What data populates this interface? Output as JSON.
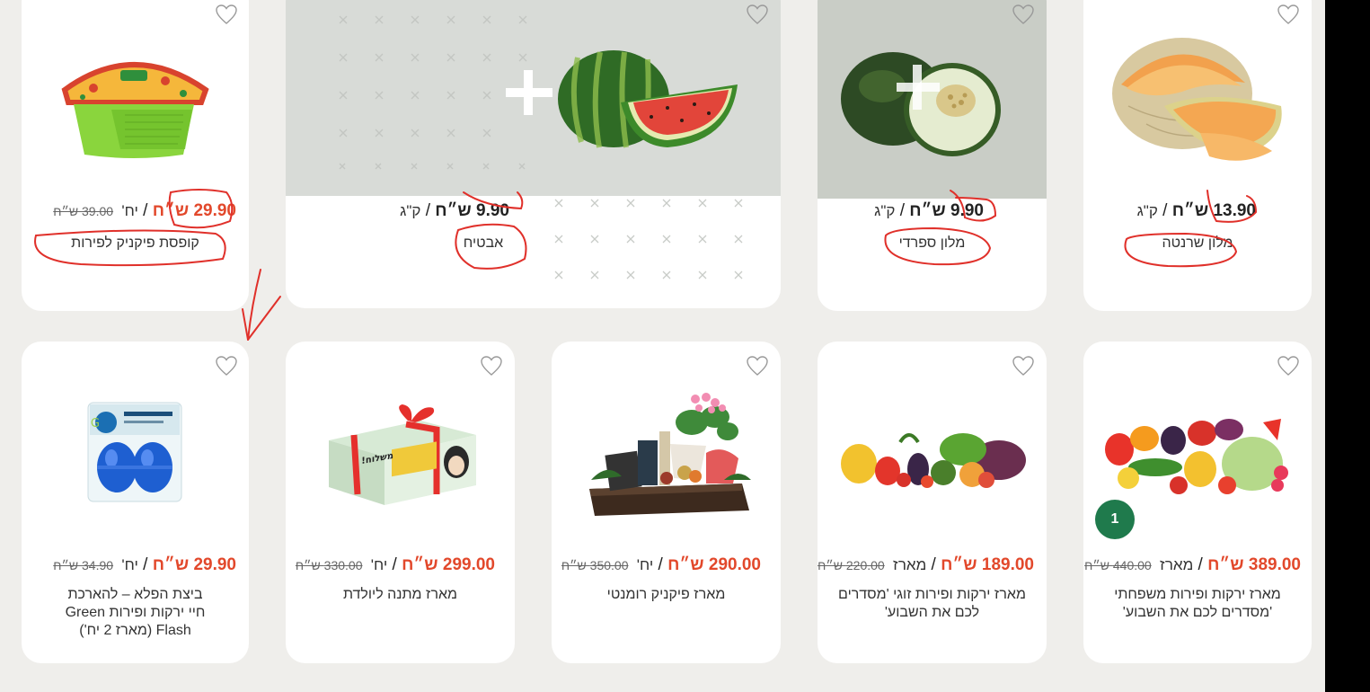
{
  "currency": "ש״ח",
  "top_row": [
    {
      "name": "קופסת פיקניק לפירות",
      "price": "29.90",
      "unit": "יח'",
      "old_price": "39.00 ש״ח",
      "image": "picnic-box-image"
    },
    {
      "name": "אבטיח",
      "price": "9.90",
      "unit": "ק\"ג",
      "image": "watermelon-image"
    },
    {
      "name": "מלון ספרדי",
      "price": "9.90",
      "unit": "ק\"ג",
      "image": "spanish-melon-image"
    },
    {
      "name": "מלון שרנטה",
      "price": "13.90",
      "unit": "ק\"ג",
      "image": "charentais-melon-image"
    }
  ],
  "bottom_row": [
    {
      "name": "ביצת הפלא – להארכת חיי ירקות ופירות Green Flash (מארז 2 יח')",
      "price": "29.90",
      "unit": "יח'",
      "old_price": "34.90 ש״ח",
      "image": "green-flash-egg-image"
    },
    {
      "name": "מארז מתנה ליולדת",
      "price": "299.00",
      "unit": "יח'",
      "old_price": "330.00 ש״ח",
      "image": "gift-box-image"
    },
    {
      "name": "מארז פיקניק רומנטי",
      "price": "290.00",
      "unit": "יח'",
      "old_price": "350.00 ש״ח",
      "image": "romantic-picnic-basket-image"
    },
    {
      "name": "מארז ירקות ופירות זוגי 'מסדרים לכם את השבוע'",
      "price": "189.00",
      "unit": "מארז",
      "old_price": "220.00 ש״ח",
      "image": "couple-veg-box-image"
    },
    {
      "name": "מארז ירקות ופירות משפחתי 'מסדרים לכם את השבוע'",
      "price": "389.00",
      "unit": "מארז",
      "old_price": "440.00 ש״ח",
      "image": "family-veg-box-image",
      "cart_count": "1"
    }
  ],
  "colors": {
    "accent_red": "#e2482b",
    "badge_green": "#1f7a4c",
    "annotation_red": "#e0302a",
    "background": "#efeeeb"
  }
}
